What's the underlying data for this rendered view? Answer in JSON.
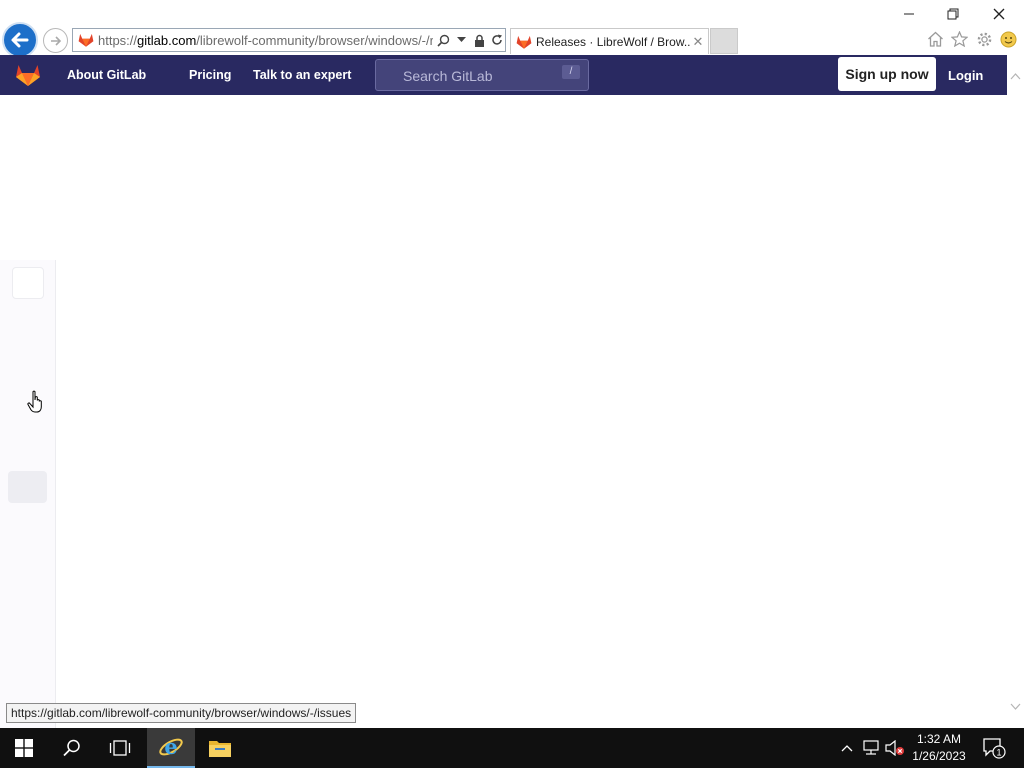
{
  "browser": {
    "url_scheme": "https://",
    "url_domain": "gitlab.com",
    "url_path": "/librewolf-community/browser/windows/-/re",
    "tab_title": "Releases · LibreWolf / Brow...",
    "tab_close": "✕",
    "window_controls": {
      "minimize": "—",
      "restore": "❐",
      "close": "✕"
    }
  },
  "navbar": {
    "about": "About GitLab",
    "pricing": "Pricing",
    "talk": "Talk to an expert",
    "search_placeholder": "Search GitLab",
    "search_shortcut": "/",
    "signup": "Sign up now",
    "login": "Login"
  },
  "status_tooltip": "https://gitlab.com/librewolf-community/browser/windows/-/issues",
  "taskbar": {
    "time": "1:32 AM",
    "date": "1/26/2023",
    "notification_count": "1"
  },
  "colors": {
    "gitlab_nav": "#292961",
    "gitlab_orange": "#fc6d26",
    "ie_back_blue": "#1d6fc9",
    "taskbar": "#101010"
  }
}
